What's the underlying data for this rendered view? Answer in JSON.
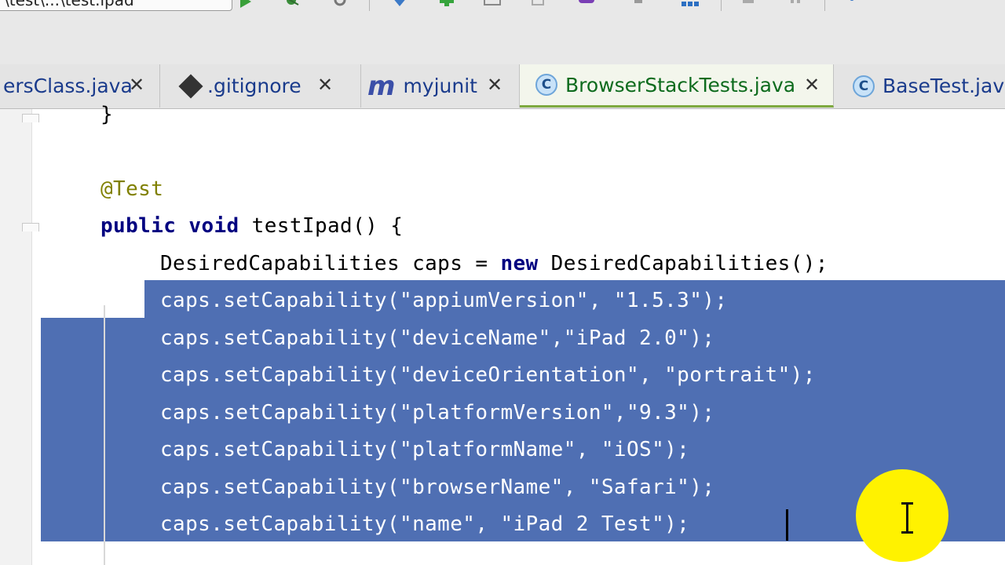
{
  "toolbar": {
    "path_text": "\\test\\...\\test.ipad",
    "buttons": [
      "run-icon",
      "debug-icon",
      "settings-icon",
      "vcs-update-icon",
      "vcs-commit-icon",
      "layout-icon",
      "copy-icon",
      "db-icon",
      "tool-icon",
      "grid-icon",
      "stop-icon",
      "pause-icon",
      "help-icon"
    ]
  },
  "tabs": [
    {
      "label": "ersClass.java",
      "icon": "class-icon"
    },
    {
      "label": ".gitignore",
      "icon": "gitignore-icon"
    },
    {
      "label": "myjunit",
      "icon": "maven-icon"
    },
    {
      "label": "BrowserStackTests.java",
      "icon": "class-icon",
      "active": true
    },
    {
      "label": "BaseTest.java",
      "icon": "class-icon"
    }
  ],
  "code": {
    "brace_line": "}",
    "annotation": "@Test",
    "method_kw1": "public",
    "method_kw2": "void",
    "method_sig": "testIpad() {",
    "decl_type": "DesiredCapabilities caps = ",
    "decl_new": "new",
    "decl_rest": " DesiredCapabilities();",
    "selected_lines": [
      "caps.setCapability(\"appiumVersion\", \"1.5.3\");",
      "caps.setCapability(\"deviceName\",\"iPad 2.0\");",
      "caps.setCapability(\"deviceOrientation\", \"portrait\");",
      "caps.setCapability(\"platformVersion\",\"9.3\");",
      "caps.setCapability(\"platformName\", \"iOS\");",
      "caps.setCapability(\"browserName\", \"Safari\");",
      "caps.setCapability(\"name\", \"iPad 2 Test\");"
    ]
  },
  "colors": {
    "selection": "#4f6fb3",
    "keyword": "#000080",
    "annotation": "#808000",
    "active_tab_text": "#0d6b1d",
    "cursor_highlight": "#fff200"
  }
}
